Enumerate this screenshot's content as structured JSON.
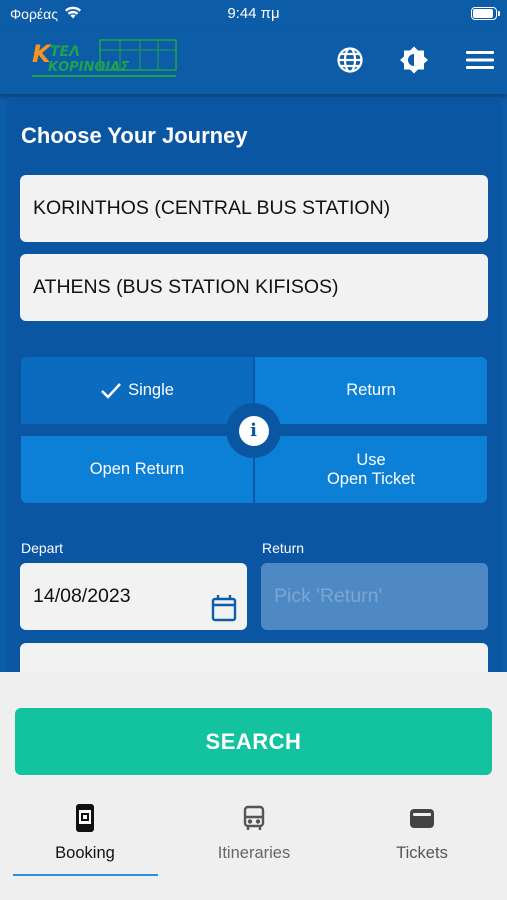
{
  "status_bar": {
    "carrier": "Φορέας",
    "time": "9:44 πμ"
  },
  "app_bar": {
    "logo_text": "KTEL KORINTHIAS",
    "icons": [
      "globe-icon",
      "brightness-icon",
      "menu-icon"
    ]
  },
  "journey": {
    "title": "Choose Your Journey",
    "from": "KORINTHOS (CENTRAL BUS STATION)",
    "to": "ATHENS (BUS STATION KIFISOS)"
  },
  "ticket_types": {
    "selected": "Single",
    "options": [
      "Single",
      "Return",
      "Open Return",
      "Use Open Ticket"
    ],
    "use_open_ticket_line1": "Use",
    "use_open_ticket_line2": "Open Ticket"
  },
  "dates": {
    "depart_label": "Depart",
    "depart_value": "14/08/2023",
    "return_label": "Return",
    "return_placeholder": "Pick 'Return'"
  },
  "search_label": "SEARCH",
  "tabs": [
    {
      "label": "Booking",
      "icon": "phone-ticket-icon",
      "active": true
    },
    {
      "label": "Itineraries",
      "icon": "bus-icon",
      "active": false
    },
    {
      "label": "Tickets",
      "icon": "wallet-icon",
      "active": false
    }
  ],
  "colors": {
    "primary": "#0d5ca8",
    "search": "#13c3a0",
    "selected_option": "#0a6bbf",
    "option": "#0c7fd6"
  }
}
